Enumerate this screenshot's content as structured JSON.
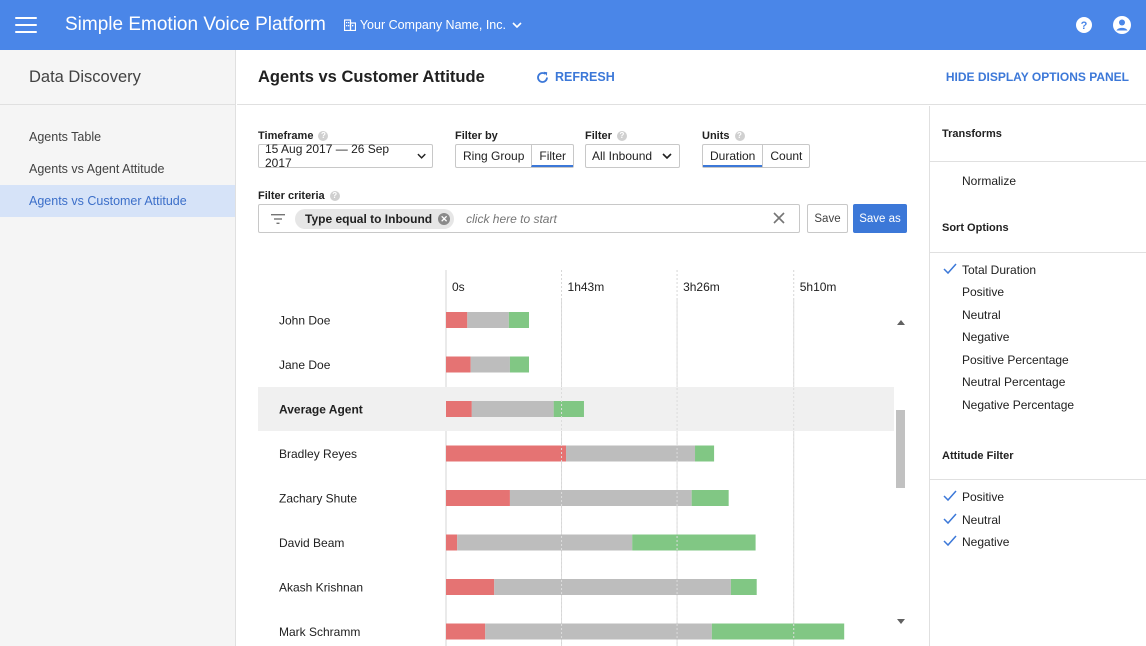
{
  "app": {
    "title": "Simple Emotion Voice Platform",
    "company": "Your Company Name, Inc.",
    "brand_color": "#4a86e8"
  },
  "leftnav": {
    "title": "Data Discovery",
    "items": [
      {
        "label": "Agents Table"
      },
      {
        "label": "Agents vs Agent Attitude"
      },
      {
        "label": "Agents vs Customer Attitude",
        "active": true
      }
    ]
  },
  "header": {
    "title": "Agents vs Customer Attitude",
    "refresh": "REFRESH",
    "hide_panel": "HIDE DISPLAY OPTIONS PANEL"
  },
  "filters": {
    "timeframe_label": "Timeframe",
    "timeframe_value": "15 Aug 2017 — 26 Sep 2017",
    "filter_by_label": "Filter by",
    "filter_by_options": [
      "Ring Group",
      "Filter"
    ],
    "filter_by_selected": "Filter",
    "filter_label": "Filter",
    "filter_value": "All Inbound",
    "units_label": "Units",
    "units_options": [
      "Duration",
      "Count"
    ],
    "units_selected": "Duration",
    "criteria_label": "Filter criteria",
    "chip": "Type equal to Inbound",
    "criteria_placeholder": "click here to start",
    "save": "Save",
    "save_as": "Save as"
  },
  "right_panel": {
    "transforms_title": "Transforms",
    "transforms": [
      "Normalize"
    ],
    "sort_title": "Sort Options",
    "sort_options": [
      {
        "label": "Total Duration",
        "checked": true
      },
      {
        "label": "Positive",
        "checked": false
      },
      {
        "label": "Neutral",
        "checked": false
      },
      {
        "label": "Negative",
        "checked": false
      },
      {
        "label": "Positive Percentage",
        "checked": false
      },
      {
        "label": "Neutral Percentage",
        "checked": false
      },
      {
        "label": "Negative Percentage",
        "checked": false
      }
    ],
    "attitude_title": "Attitude Filter",
    "attitude_options": [
      {
        "label": "Positive",
        "checked": true
      },
      {
        "label": "Neutral",
        "checked": true
      },
      {
        "label": "Negative",
        "checked": true
      }
    ],
    "check_color": "#3c78d8"
  },
  "chart_data": {
    "type": "bar",
    "orientation": "horizontal",
    "stacked": true,
    "x_ticks": [
      "0s",
      "1h43m",
      "3h26m",
      "5h10m"
    ],
    "x_tick_minutes": [
      0,
      103,
      206,
      310
    ],
    "unit": "minutes",
    "series": [
      {
        "name": "Negative",
        "color": "#e57373"
      },
      {
        "name": "Neutral",
        "color": "#bdbdbd"
      },
      {
        "name": "Positive",
        "color": "#81c784"
      }
    ],
    "rows": [
      {
        "label": "John Doe",
        "values": [
          19,
          37,
          18
        ]
      },
      {
        "label": "Jane Doe",
        "values": [
          22,
          35,
          17
        ]
      },
      {
        "label": "Average Agent",
        "values": [
          23,
          73,
          27
        ],
        "highlight": true
      },
      {
        "label": "Bradley Reyes",
        "values": [
          107,
          115,
          17
        ]
      },
      {
        "label": "Zachary Shute",
        "values": [
          57,
          162,
          33
        ]
      },
      {
        "label": "David Beam",
        "values": [
          10,
          156,
          110
        ]
      },
      {
        "label": "Akash Krishnan",
        "values": [
          43,
          211,
          23
        ]
      },
      {
        "label": "Mark Schramm",
        "values": [
          35,
          202,
          118
        ]
      }
    ]
  }
}
